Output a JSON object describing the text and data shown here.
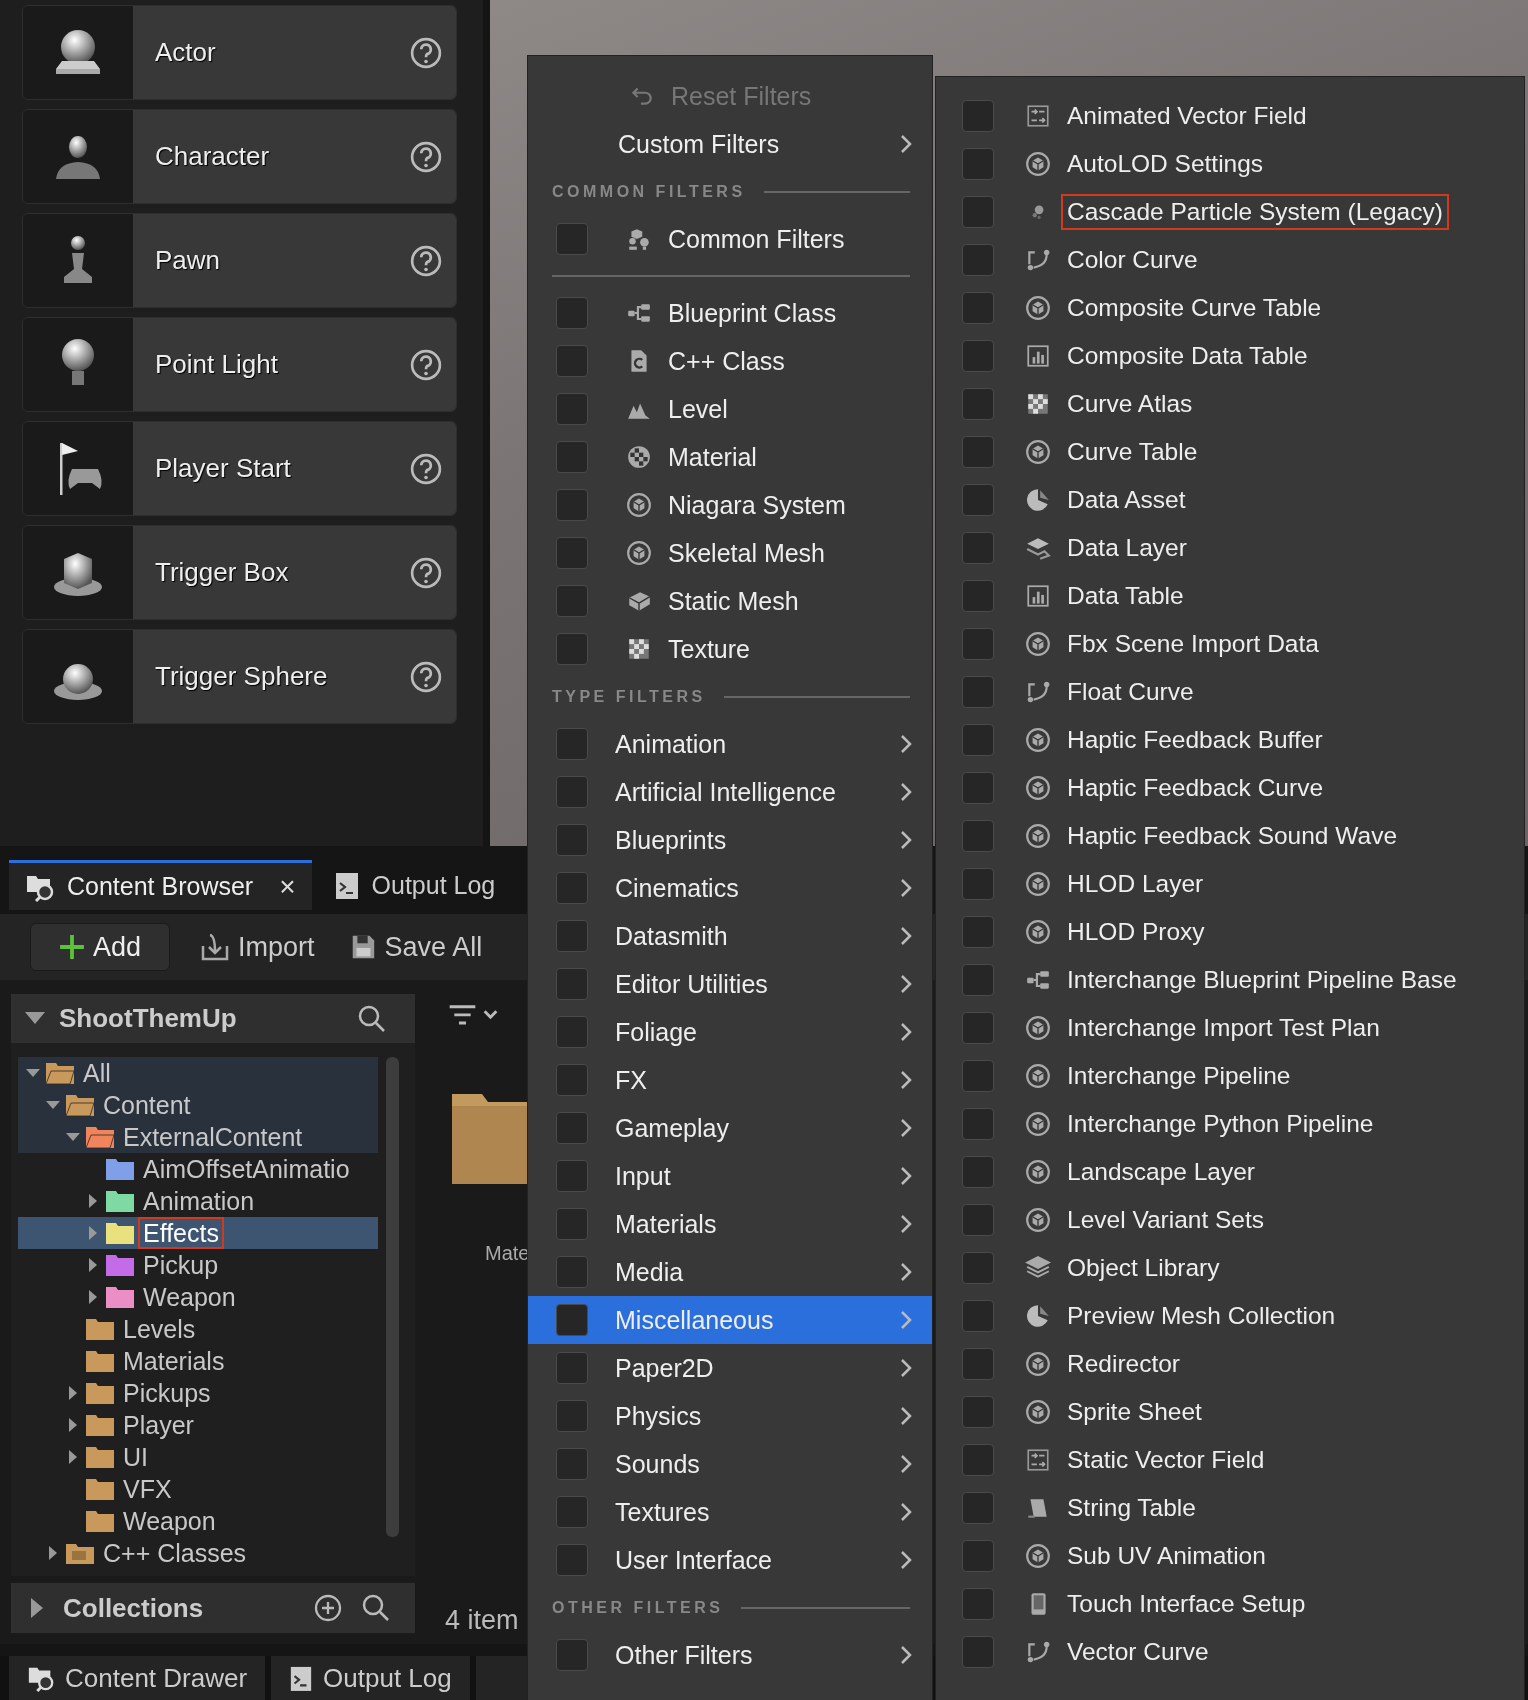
{
  "place_actors": [
    {
      "label": "Actor"
    },
    {
      "label": "Character"
    },
    {
      "label": "Pawn"
    },
    {
      "label": "Point Light"
    },
    {
      "label": "Player Start"
    },
    {
      "label": "Trigger Box"
    },
    {
      "label": "Trigger Sphere"
    }
  ],
  "content_browser": {
    "tabs": [
      {
        "label": "Content Browser",
        "selected": true,
        "closable": true
      },
      {
        "label": "Output Log",
        "selected": false,
        "closable": false
      }
    ],
    "close_glyph": "×",
    "toolbar": [
      {
        "label": "Add",
        "kind": "primary"
      },
      {
        "label": "Import",
        "kind": "plain"
      },
      {
        "label": "Save All",
        "kind": "plain"
      }
    ],
    "tree": {
      "title": "ShootThemUp",
      "nodes": [
        {
          "label": "All",
          "kind": "folder",
          "color": "#c8995a",
          "expandable": true,
          "expanded": true,
          "selected": false,
          "outlined": false,
          "children": [
            {
              "label": "Content",
              "kind": "folder",
              "color": "#c8995a",
              "expandable": true,
              "expanded": true,
              "selected": false,
              "outlined": false,
              "children": [
                {
                  "label": "ExternalContent",
                  "kind": "folder",
                  "color": "#f0845a",
                  "expandable": true,
                  "expanded": true,
                  "selected": false,
                  "outlined": false,
                  "children": [
                    {
                      "label": "AimOffsetAnimatio",
                      "kind": "folder",
                      "color": "#7f9fe8",
                      "expandable": false,
                      "expanded": false,
                      "selected": false,
                      "outlined": false
                    },
                    {
                      "label": "Animation",
                      "kind": "folder",
                      "color": "#7ed9a2",
                      "expandable": true,
                      "expanded": false,
                      "selected": false,
                      "outlined": false
                    },
                    {
                      "label": "Effects",
                      "kind": "folder",
                      "color": "#e9e07e",
                      "expandable": true,
                      "expanded": false,
                      "selected": true,
                      "outlined": true
                    },
                    {
                      "label": "Pickup",
                      "kind": "folder",
                      "color": "#c46be8",
                      "expandable": true,
                      "expanded": false,
                      "selected": false,
                      "outlined": false
                    },
                    {
                      "label": "Weapon",
                      "kind": "folder",
                      "color": "#ec8ec6",
                      "expandable": true,
                      "expanded": false,
                      "selected": false,
                      "outlined": false
                    }
                  ]
                },
                {
                  "label": "Levels",
                  "kind": "folder",
                  "color": "#c8995a",
                  "expandable": false,
                  "expanded": false,
                  "selected": false,
                  "outlined": false
                },
                {
                  "label": "Materials",
                  "kind": "folder",
                  "color": "#c8995a",
                  "expandable": false,
                  "expanded": false,
                  "selected": false,
                  "outlined": false
                },
                {
                  "label": "Pickups",
                  "kind": "folder",
                  "color": "#c8995a",
                  "expandable": true,
                  "expanded": false,
                  "selected": false,
                  "outlined": false
                },
                {
                  "label": "Player",
                  "kind": "folder",
                  "color": "#c8995a",
                  "expandable": true,
                  "expanded": false,
                  "selected": false,
                  "outlined": false
                },
                {
                  "label": "UI",
                  "kind": "folder",
                  "color": "#c8995a",
                  "expandable": true,
                  "expanded": false,
                  "selected": false,
                  "outlined": false
                },
                {
                  "label": "VFX",
                  "kind": "folder",
                  "color": "#c8995a",
                  "expandable": false,
                  "expanded": false,
                  "selected": false,
                  "outlined": false
                },
                {
                  "label": "Weapon",
                  "kind": "folder",
                  "color": "#c8995a",
                  "expandable": false,
                  "expanded": false,
                  "selected": false,
                  "outlined": false
                }
              ]
            },
            {
              "label": "C++ Classes",
              "kind": "code",
              "color": "#c8995a",
              "expandable": true,
              "expanded": false,
              "selected": false,
              "outlined": false
            }
          ]
        }
      ]
    },
    "collections": "Collections",
    "asset_label": "Mate",
    "item_count": "4 item",
    "bottom_tabs": [
      {
        "label": "Content Drawer"
      },
      {
        "label": "Output Log"
      }
    ]
  },
  "filter_menu": {
    "items": [
      {
        "kind": "action",
        "label": "Reset Filters",
        "disabled": true
      },
      {
        "kind": "submenu",
        "label": "Custom Filters"
      },
      {
        "kind": "header",
        "label": "COMMON FILTERS"
      },
      {
        "kind": "check",
        "label": "Common Filters",
        "checked": false
      },
      {
        "kind": "divider"
      },
      {
        "kind": "check",
        "label": "Blueprint Class",
        "checked": false
      },
      {
        "kind": "check",
        "label": "C++ Class",
        "checked": false
      },
      {
        "kind": "check",
        "label": "Level",
        "checked": false
      },
      {
        "kind": "check",
        "label": "Material",
        "checked": false
      },
      {
        "kind": "check",
        "label": "Niagara System",
        "checked": false
      },
      {
        "kind": "check",
        "label": "Skeletal Mesh",
        "checked": false
      },
      {
        "kind": "check",
        "label": "Static Mesh",
        "checked": false
      },
      {
        "kind": "check",
        "label": "Texture",
        "checked": false
      },
      {
        "kind": "header",
        "label": "TYPE FILTERS"
      },
      {
        "kind": "checksub",
        "label": "Animation",
        "checked": false,
        "selected": false
      },
      {
        "kind": "checksub",
        "label": "Artificial Intelligence",
        "checked": false,
        "selected": false
      },
      {
        "kind": "checksub",
        "label": "Blueprints",
        "checked": false,
        "selected": false
      },
      {
        "kind": "checksub",
        "label": "Cinematics",
        "checked": false,
        "selected": false
      },
      {
        "kind": "checksub",
        "label": "Datasmith",
        "checked": false,
        "selected": false
      },
      {
        "kind": "checksub",
        "label": "Editor Utilities",
        "checked": false,
        "selected": false
      },
      {
        "kind": "checksub",
        "label": "Foliage",
        "checked": false,
        "selected": false
      },
      {
        "kind": "checksub",
        "label": "FX",
        "checked": false,
        "selected": false
      },
      {
        "kind": "checksub",
        "label": "Gameplay",
        "checked": false,
        "selected": false
      },
      {
        "kind": "checksub",
        "label": "Input",
        "checked": false,
        "selected": false
      },
      {
        "kind": "checksub",
        "label": "Materials",
        "checked": false,
        "selected": false
      },
      {
        "kind": "checksub",
        "label": "Media",
        "checked": false,
        "selected": false
      },
      {
        "kind": "checksub",
        "label": "Miscellaneous",
        "checked": false,
        "selected": true
      },
      {
        "kind": "checksub",
        "label": "Paper2D",
        "checked": false,
        "selected": false
      },
      {
        "kind": "checksub",
        "label": "Physics",
        "checked": false,
        "selected": false
      },
      {
        "kind": "checksub",
        "label": "Sounds",
        "checked": false,
        "selected": false
      },
      {
        "kind": "checksub",
        "label": "Textures",
        "checked": false,
        "selected": false
      },
      {
        "kind": "checksub",
        "label": "User Interface",
        "checked": false,
        "selected": false
      },
      {
        "kind": "header",
        "label": "OTHER FILTERS"
      },
      {
        "kind": "checksub",
        "label": "Other Filters",
        "checked": false,
        "selected": false
      }
    ]
  },
  "submenu": {
    "items": [
      {
        "label": "Animated Vector Field",
        "checked": false,
        "outlined": false
      },
      {
        "label": "AutoLOD Settings",
        "checked": false,
        "outlined": false
      },
      {
        "label": "Cascade Particle System (Legacy)",
        "checked": false,
        "outlined": true
      },
      {
        "label": "Color Curve",
        "checked": false,
        "outlined": false
      },
      {
        "label": "Composite Curve Table",
        "checked": false,
        "outlined": false
      },
      {
        "label": "Composite Data Table",
        "checked": false,
        "outlined": false
      },
      {
        "label": "Curve Atlas",
        "checked": false,
        "outlined": false
      },
      {
        "label": "Curve Table",
        "checked": false,
        "outlined": false
      },
      {
        "label": "Data Asset",
        "checked": false,
        "outlined": false
      },
      {
        "label": "Data Layer",
        "checked": false,
        "outlined": false
      },
      {
        "label": "Data Table",
        "checked": false,
        "outlined": false
      },
      {
        "label": "Fbx Scene Import Data",
        "checked": false,
        "outlined": false
      },
      {
        "label": "Float Curve",
        "checked": false,
        "outlined": false
      },
      {
        "label": "Haptic Feedback Buffer",
        "checked": false,
        "outlined": false
      },
      {
        "label": "Haptic Feedback Curve",
        "checked": false,
        "outlined": false
      },
      {
        "label": "Haptic Feedback Sound Wave",
        "checked": false,
        "outlined": false
      },
      {
        "label": "HLOD Layer",
        "checked": false,
        "outlined": false
      },
      {
        "label": "HLOD Proxy",
        "checked": false,
        "outlined": false
      },
      {
        "label": "Interchange Blueprint Pipeline Base",
        "checked": false,
        "outlined": false
      },
      {
        "label": "Interchange Import Test Plan",
        "checked": false,
        "outlined": false
      },
      {
        "label": "Interchange Pipeline",
        "checked": false,
        "outlined": false
      },
      {
        "label": "Interchange Python Pipeline",
        "checked": false,
        "outlined": false
      },
      {
        "label": "Landscape Layer",
        "checked": false,
        "outlined": false
      },
      {
        "label": "Level Variant Sets",
        "checked": false,
        "outlined": false
      },
      {
        "label": "Object Library",
        "checked": false,
        "outlined": false
      },
      {
        "label": "Preview Mesh Collection",
        "checked": false,
        "outlined": false
      },
      {
        "label": "Redirector",
        "checked": false,
        "outlined": false
      },
      {
        "label": "Sprite Sheet",
        "checked": false,
        "outlined": false
      },
      {
        "label": "Static Vector Field",
        "checked": false,
        "outlined": false
      },
      {
        "label": "String Table",
        "checked": false,
        "outlined": false
      },
      {
        "label": "Sub UV Animation",
        "checked": false,
        "outlined": false
      },
      {
        "label": "Touch Interface Setup",
        "checked": false,
        "outlined": false
      },
      {
        "label": "Vector Curve",
        "checked": false,
        "outlined": false
      }
    ]
  }
}
